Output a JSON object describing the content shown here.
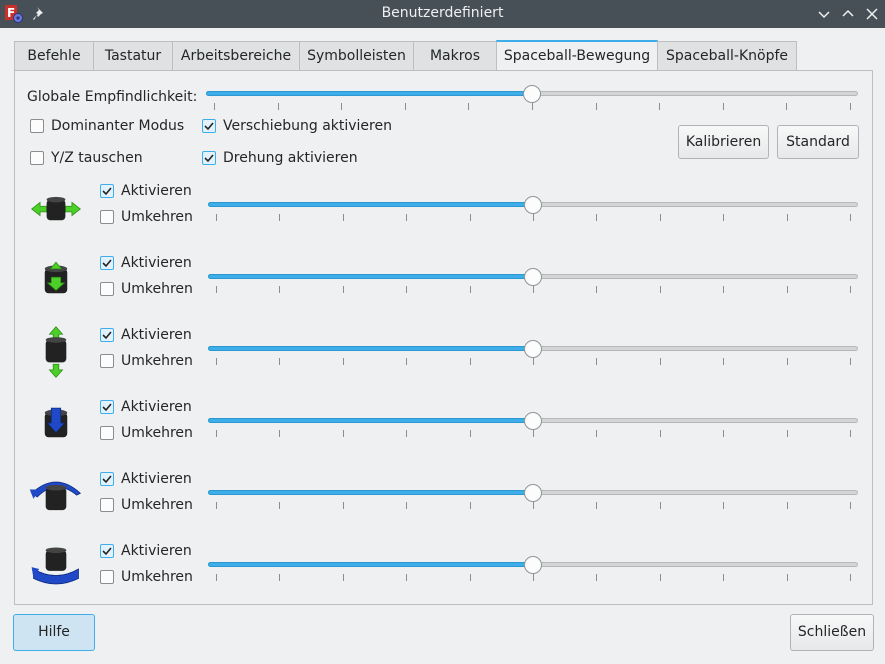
{
  "window": {
    "title": "Benutzerdefiniert",
    "app_icon": "freecad-icon",
    "pin_icon": "pin-icon"
  },
  "tabs": [
    {
      "label": "Befehle",
      "active": false
    },
    {
      "label": "Tastatur",
      "active": false
    },
    {
      "label": "Arbeitsbereiche",
      "active": false
    },
    {
      "label": "Symbolleisten",
      "active": false
    },
    {
      "label": "Makros",
      "active": false
    },
    {
      "label": "Spaceball-Bewegung",
      "active": true
    },
    {
      "label": "Spaceball-Knöpfe",
      "active": false
    }
  ],
  "settings": {
    "global_sensitivity_label": "Globale Empfindlichkeit:",
    "global_sensitivity_fraction": 0.5,
    "dominant_mode": {
      "label": "Dominanter Modus",
      "checked": false
    },
    "translation": {
      "label": "Verschiebung aktivieren",
      "checked": true
    },
    "flip_yz": {
      "label": "Y/Z tauschen",
      "checked": false
    },
    "rotation": {
      "label": "Drehung aktivieren",
      "checked": true
    },
    "calibrate_label": "Kalibrieren",
    "default_label": "Standard"
  },
  "axes": [
    {
      "icon": "pan-left-right-icon",
      "enable_label": "Aktivieren",
      "enabled": true,
      "reverse_label": "Umkehren",
      "reversed": false,
      "sensitivity_fraction": 0.5
    },
    {
      "icon": "pan-up-down-icon",
      "enable_label": "Aktivieren",
      "enabled": true,
      "reverse_label": "Umkehren",
      "reversed": false,
      "sensitivity_fraction": 0.5
    },
    {
      "icon": "zoom-in-out-icon",
      "enable_label": "Aktivieren",
      "enabled": true,
      "reverse_label": "Umkehren",
      "reversed": false,
      "sensitivity_fraction": 0.5
    },
    {
      "icon": "tilt-icon",
      "enable_label": "Aktivieren",
      "enabled": true,
      "reverse_label": "Umkehren",
      "reversed": false,
      "sensitivity_fraction": 0.5
    },
    {
      "icon": "roll-icon",
      "enable_label": "Aktivieren",
      "enabled": true,
      "reverse_label": "Umkehren",
      "reversed": false,
      "sensitivity_fraction": 0.5
    },
    {
      "icon": "spin-icon",
      "enable_label": "Aktivieren",
      "enabled": true,
      "reverse_label": "Umkehren",
      "reversed": false,
      "sensitivity_fraction": 0.5
    }
  ],
  "footer": {
    "help_label": "Hilfe",
    "close_label": "Schließen"
  },
  "colors": {
    "accent": "#3daee9",
    "titlebar": "#475057",
    "translation_arrow": "#4ccf29",
    "rotation_arrow": "#1f49c7"
  }
}
